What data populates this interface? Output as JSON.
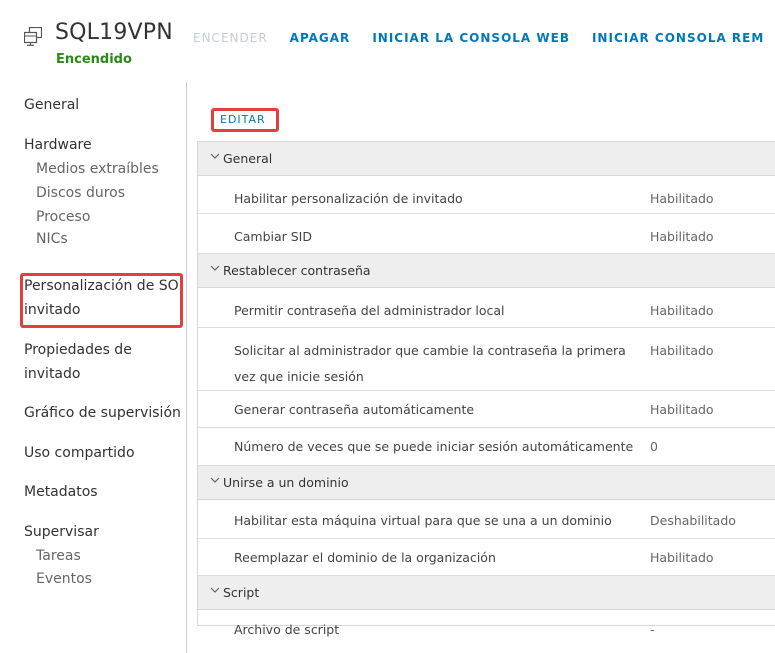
{
  "vm": {
    "name": "SQL19VPN",
    "status": "Encendido",
    "status_color": "#2a8a17",
    "icon": "vm-icon"
  },
  "actions": [
    {
      "label": "ENCENDER",
      "enabled": false
    },
    {
      "label": "APAGAR",
      "enabled": true
    },
    {
      "label": "INICIAR LA CONSOLA WEB",
      "enabled": true
    },
    {
      "label": "INICIAR CONSOLA REM",
      "enabled": true
    }
  ],
  "sidebar": {
    "general": "General",
    "hardware": "Hardware",
    "hardware_items": [
      "Medios extraíbles",
      "Discos duros",
      "Proceso",
      "NICs"
    ],
    "guest_customization": "Personalización de SO invitado",
    "guest_properties": "Propiedades de invitado",
    "monitoring_chart": "Gráfico de supervisión",
    "sharing": "Uso compartido",
    "metadata": "Metadatos",
    "monitor": "Supervisar",
    "monitor_items": [
      "Tareas",
      "Eventos"
    ],
    "selected": "Personalización de SO invitado"
  },
  "main": {
    "edit_label": "EDITAR",
    "sections": [
      {
        "title": "General",
        "rows": [
          {
            "label": "Habilitar personalización de invitado",
            "value": "Habilitado"
          },
          {
            "label": "Cambiar SID",
            "value": "Habilitado"
          }
        ]
      },
      {
        "title": "Restablecer contraseña",
        "rows": [
          {
            "label": "Permitir contraseña del administrador local",
            "value": "Habilitado"
          },
          {
            "label": "Solicitar al administrador que cambie la contraseña la primera vez que inicie sesión",
            "value": "Habilitado"
          },
          {
            "label": "Generar contraseña automáticamente",
            "value": "Habilitado"
          },
          {
            "label": "Número de veces que se puede iniciar sesión automáticamente",
            "value": "0"
          }
        ]
      },
      {
        "title": "Unirse a un dominio",
        "rows": [
          {
            "label": "Habilitar esta máquina virtual para que se una a un dominio",
            "value": "Deshabilitado"
          },
          {
            "label": "Reemplazar el dominio de la organización",
            "value": "Habilitado"
          }
        ]
      },
      {
        "title": "Script",
        "rows": [
          {
            "label": "Archivo de script",
            "value": "-"
          }
        ]
      }
    ]
  },
  "colors": {
    "accent": "#0079b8",
    "highlight": "#e04040",
    "section_bg": "#eeeeee",
    "disabled": "#c4ced4"
  }
}
